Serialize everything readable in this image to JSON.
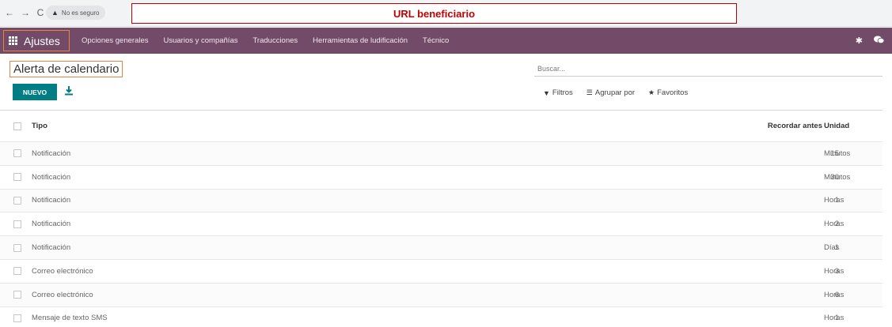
{
  "browser": {
    "nav": {
      "back": "←",
      "forward": "→",
      "reload": "C"
    },
    "security_text": "No es seguro",
    "url_label": "URL beneficiario"
  },
  "navbar": {
    "app_name": "Ajustes",
    "menu": [
      "Opciones generales",
      "Usuarios y compañías",
      "Traducciones",
      "Herramientas de ludificación",
      "Técnico"
    ]
  },
  "page": {
    "title": "Alerta de calendario",
    "search_placeholder": "Buscar...",
    "new_button": "NUEVO",
    "filters_label": "Filtros",
    "group_by_label": "Agrupar por",
    "favorites_label": "Favoritos"
  },
  "table": {
    "headers": {
      "type": "Tipo",
      "remind_before": "Recordar antes",
      "unit": "Unidad"
    },
    "rows": [
      {
        "type": "Notificación",
        "remind_before": "15",
        "unit": "Minutos"
      },
      {
        "type": "Notificación",
        "remind_before": "30",
        "unit": "Minutos"
      },
      {
        "type": "Notificación",
        "remind_before": "1",
        "unit": "Horas"
      },
      {
        "type": "Notificación",
        "remind_before": "2",
        "unit": "Horas"
      },
      {
        "type": "Notificación",
        "remind_before": "1",
        "unit": "Días"
      },
      {
        "type": "Correo electrónico",
        "remind_before": "3",
        "unit": "Horas"
      },
      {
        "type": "Correo electrónico",
        "remind_before": "6",
        "unit": "Horas"
      },
      {
        "type": "Mensaje de texto SMS",
        "remind_before": "1",
        "unit": "Horas"
      }
    ]
  },
  "colors": {
    "navbar": "#714b67",
    "primary_button": "#017e84",
    "highlight_box": "#e8823c",
    "url_annotation": "#c00000"
  },
  "icons": {
    "apps": "apps-grid-icon",
    "download": "download-icon",
    "filter": "funnel-icon",
    "group_by": "layers-icon",
    "favorites": "star-icon",
    "warning": "warning-triangle-icon",
    "bug": "bug-icon",
    "chat": "chat-icon"
  }
}
